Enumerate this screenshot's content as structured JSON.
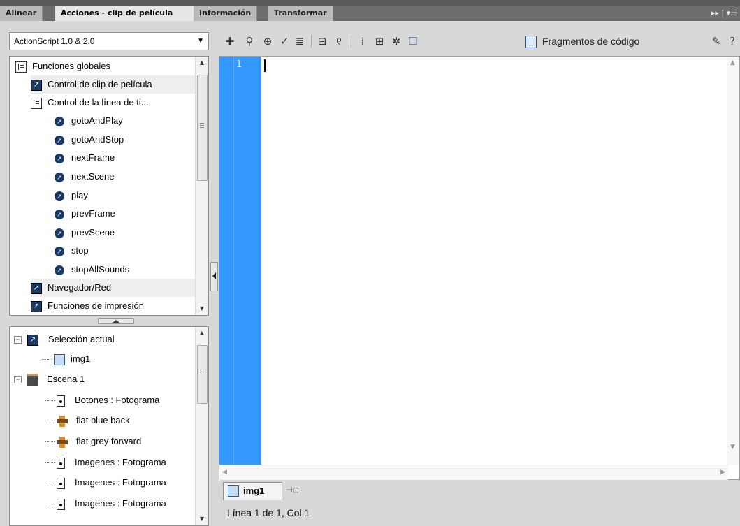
{
  "tabs": [
    {
      "label": "Alinear",
      "active": false
    },
    {
      "label": "Acciones - clip de película",
      "active": true
    },
    {
      "label": "Información",
      "active": false
    },
    {
      "label": "Transformar",
      "active": false
    }
  ],
  "tab_menu_glyph": "▸▸ | ▾☰",
  "language_selector": {
    "value": "ActionScript 1.0 & 2.0"
  },
  "toolbox": {
    "items": [
      {
        "label": "Funciones globales",
        "icon": "book-icon"
      },
      {
        "label": "Control de clip de película",
        "icon": "action-folder-icon"
      },
      {
        "label": "Control de la línea de ti...",
        "icon": "book-icon"
      },
      {
        "label": "gotoAndPlay",
        "icon": "action-icon"
      },
      {
        "label": "gotoAndStop",
        "icon": "action-icon"
      },
      {
        "label": "nextFrame",
        "icon": "action-icon"
      },
      {
        "label": "nextScene",
        "icon": "action-icon"
      },
      {
        "label": "play",
        "icon": "action-icon"
      },
      {
        "label": "prevFrame",
        "icon": "action-icon"
      },
      {
        "label": "prevScene",
        "icon": "action-icon"
      },
      {
        "label": "stop",
        "icon": "action-icon"
      },
      {
        "label": "stopAllSounds",
        "icon": "action-icon"
      },
      {
        "label": "Navegador/Red",
        "icon": "action-folder-icon"
      },
      {
        "label": "Funciones de impresión",
        "icon": "action-folder-icon"
      }
    ]
  },
  "script_navigator": {
    "items": [
      {
        "label": "Selección actual",
        "icon": "current-selection-icon"
      },
      {
        "label": "img1",
        "icon": "movieclip-icon"
      },
      {
        "label": "Escena 1",
        "icon": "scene-icon"
      },
      {
        "label": "Botones : Fotograma",
        "icon": "frame-icon"
      },
      {
        "label": "flat blue back",
        "icon": "button-symbol-icon"
      },
      {
        "label": "flat grey forward",
        "icon": "button-symbol-icon"
      },
      {
        "label": "Imagenes : Fotograma",
        "icon": "frame-icon"
      },
      {
        "label": "Imagenes : Fotograma",
        "icon": "frame-icon"
      },
      {
        "label": "Imagenes : Fotograma",
        "icon": "frame-icon"
      }
    ]
  },
  "toolbar": {
    "snippets_label": "Fragmentos de código",
    "icons": [
      "add-statement-icon",
      "find-icon",
      "insert-target-path-icon",
      "check-syntax-icon",
      "auto-format-icon",
      "show-code-hint-icon",
      "debug-options-icon",
      "collapse-between-braces-icon",
      "collapse-selection-icon",
      "expand-all-icon",
      "apply-block-comment-icon",
      "script-assist-icon",
      "help-icon"
    ]
  },
  "editor": {
    "line_number": "1"
  },
  "doc_tab": {
    "label": "img1"
  },
  "status": {
    "text": "Línea 1 de 1, Col 1"
  },
  "colors": {
    "gutter": "#3399ff",
    "panel_bg": "#d8d8d8"
  }
}
